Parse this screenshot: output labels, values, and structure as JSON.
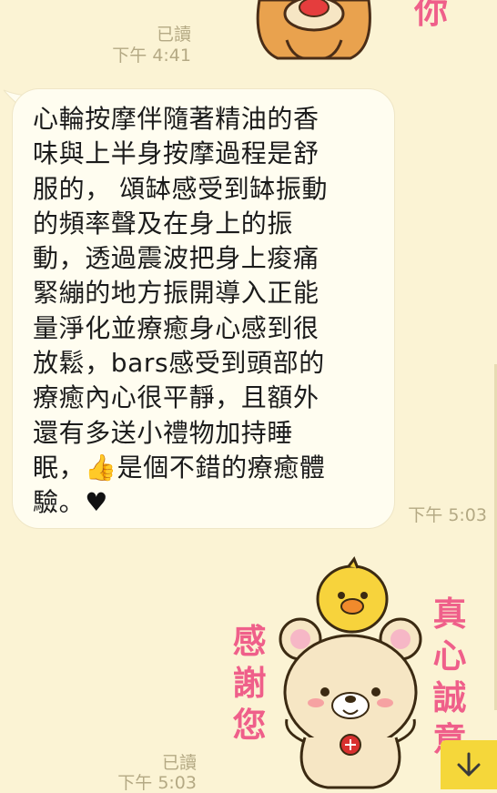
{
  "top_message": {
    "read_label": "已讀",
    "time": "下午 4:41"
  },
  "main_message": {
    "lines": [
      "心輪按摩伴隨著精油的香",
      "味與上半身按摩過程是舒",
      "服的， 頌缽感受到缽振動",
      "的頻率聲及在身上的振",
      "動，透過震波把身上痠痛",
      "緊繃的地方振開導入正能",
      "量淨化並療癒身心感到很",
      "放鬆，bars感受到頭部的",
      "療癒內心很平靜，且額外",
      "還有多送小禮物加持睡",
      "眠，",
      "驗。"
    ],
    "line11_tail": "是個不錯的療癒體",
    "thumbs_emoji": "👍",
    "heart_emoji": "♥",
    "time": "下午 5:03"
  },
  "sticker": {
    "left_text": [
      "感",
      "謝",
      "您"
    ],
    "right_text": [
      "真",
      "心",
      "誠",
      "意"
    ],
    "read_label": "已讀",
    "time": "下午 5:03",
    "colors": {
      "text": "#ef5f8a",
      "bear": "#f6e6c4",
      "chick": "#f7d33c"
    }
  },
  "scroll_button": {
    "icon": "arrow-down-icon"
  }
}
